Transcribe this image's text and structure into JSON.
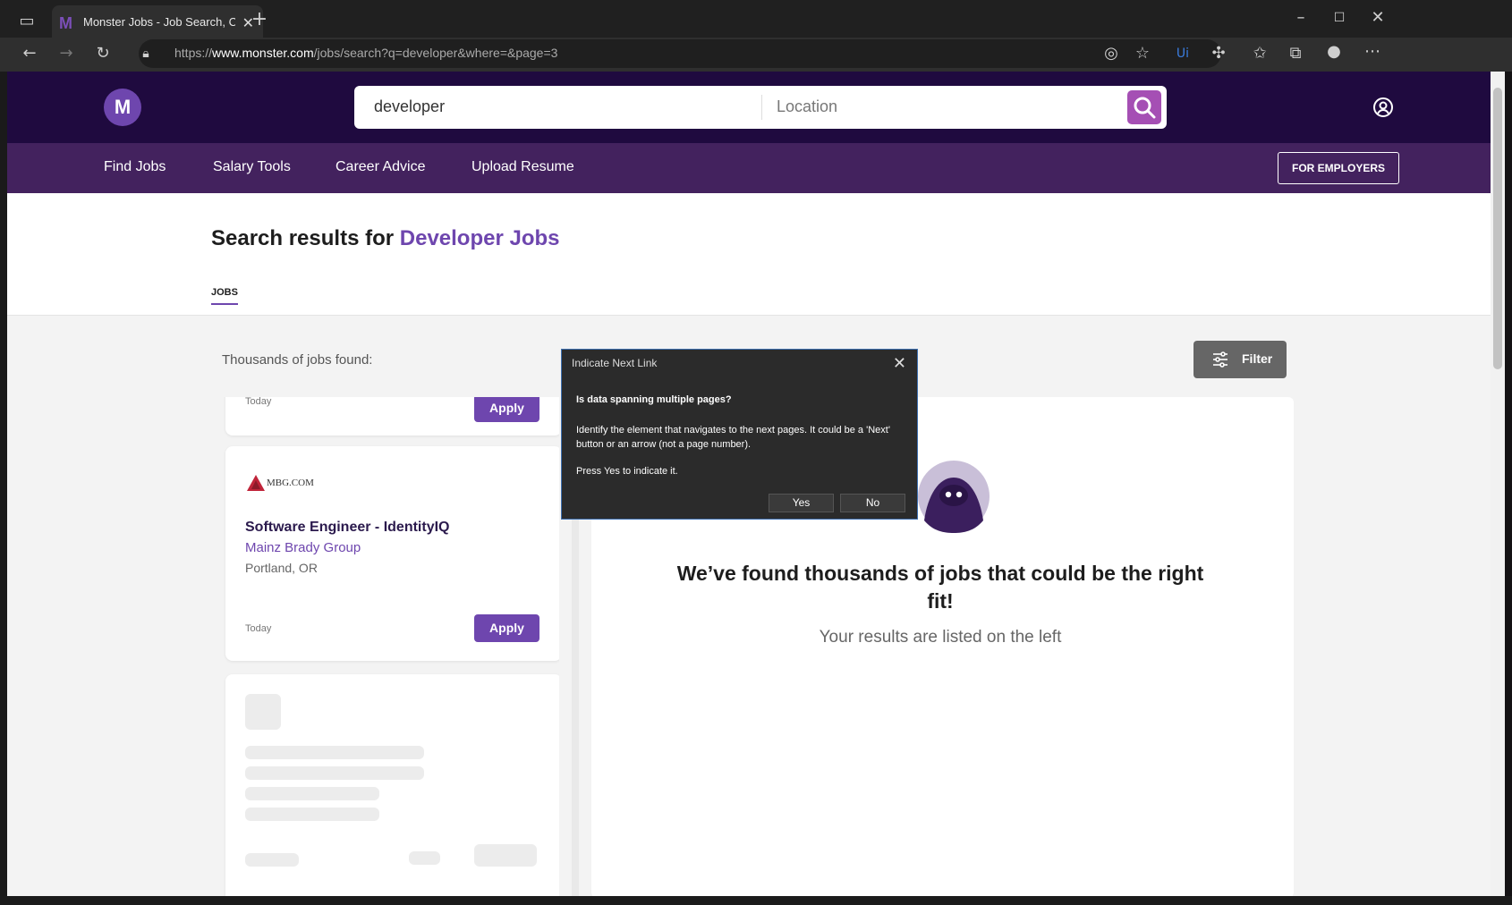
{
  "browser": {
    "tab_title": "Monster Jobs - Job Search, Career",
    "url_prefix": "https://",
    "url_domain": "www.monster.com",
    "url_path": "/jobs/search?q=developer&where=&page=3"
  },
  "header": {
    "logo_letter": "M",
    "search_query": "developer",
    "location_placeholder": "Location"
  },
  "nav": {
    "items": [
      "Find Jobs",
      "Salary Tools",
      "Career Advice",
      "Upload Resume"
    ],
    "employers_button": "FOR EMPLOYERS"
  },
  "results": {
    "title_prefix": "Search results for",
    "title_query": "Developer Jobs",
    "tab_jobs": "JOBS",
    "found_text": "Thousands of jobs found:",
    "filter_label": "Filter"
  },
  "jobs": [
    {
      "date": "Today",
      "apply": "Apply"
    },
    {
      "company_logo_text": "MBG.COM",
      "title": "Software Engineer - IdentityIQ",
      "company": "Mainz Brady Group",
      "location": "Portland, OR",
      "date": "Today",
      "apply": "Apply"
    }
  ],
  "detail": {
    "headline": "We’ve found thousands of jobs that could be the right fit!",
    "sub": "Your results are listed on the left"
  },
  "dialog": {
    "title": "Indicate Next Link",
    "question": "Is data spanning multiple pages?",
    "description": "Identify the element that navigates to the next pages. It could be a 'Next' button or an arrow (not a page number).",
    "hint": "Press Yes to indicate it.",
    "yes": "Yes",
    "no": "No"
  },
  "colors": {
    "brand_purple": "#6e46ae",
    "header_dark": "#1f0a3f",
    "nav_purple": "#43225e",
    "search_button": "#a54fb4"
  }
}
